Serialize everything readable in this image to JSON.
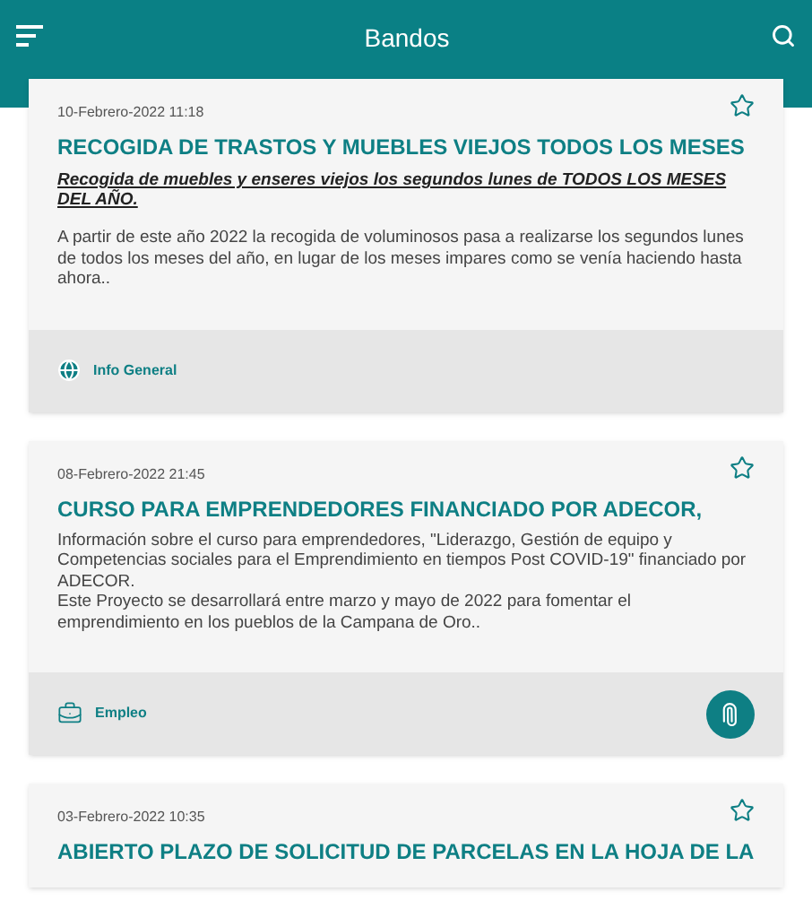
{
  "app_bar": {
    "title": "Bandos"
  },
  "posts": [
    {
      "date": "10-Febrero-2022 11:18",
      "starred": false,
      "title": "RECOGIDA DE TRASTOS Y MUEBLES  VIEJOS TODOS LOS MESES",
      "subtitle": "Recogida de muebles y enseres viejos los segundos lunes de TODOS LOS MESES DEL AÑO.",
      "body": [
        "A partir de este año 2022 la recogida de voluminosos pasa a realizarse los segundos lunes de todos los meses del año, en lugar de los meses impares como se venía haciendo hasta ahora.."
      ],
      "category": {
        "kind": "globe",
        "label": "Info General"
      },
      "attachment": false
    },
    {
      "date": "08-Febrero-2022 21:45",
      "starred": false,
      "title": "CURSO PARA EMPRENDEDORES FINANCIADO POR ADECOR,",
      "body": [
        "Información sobre el curso para emprendedores, \"Liderazgo, Gestión de equipo y Competencias sociales para el Emprendimiento en tiempos Post COVID-19\" financiado por ADECOR.",
        "Este Proyecto se desarrollará entre marzo y mayo de 2022 para fomentar el emprendimiento en los pueblos de la Campana de Oro.."
      ],
      "category": {
        "kind": "briefcase",
        "label": "Empleo"
      },
      "attachment": true
    },
    {
      "date": "03-Febrero-2022 10:35",
      "starred": false,
      "title": "ABIERTO PLAZO DE SOLICITUD DE PARCELAS EN LA HOJA DE LA"
    }
  ]
}
